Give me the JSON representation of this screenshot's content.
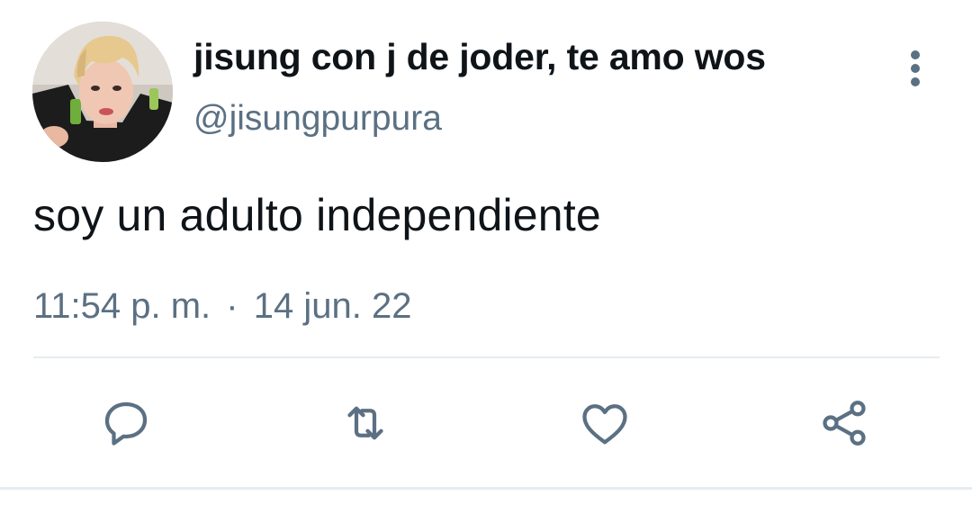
{
  "author": {
    "display_name": "jisung con j de joder, te amo wos",
    "handle": "@jisungpurpura"
  },
  "tweet": {
    "text": "soy un adulto independiente",
    "time": "11:54 p. m.",
    "separator": "·",
    "date": "14 jun. 22"
  },
  "actions": {
    "reply": "reply-icon",
    "retweet": "retweet-icon",
    "like": "heart-icon",
    "share": "share-icon",
    "more": "more-vertical-icon"
  },
  "colors": {
    "text": "#0f1419",
    "secondary": "#5b7083",
    "divider": "#e6ecf0",
    "background": "#ffffff"
  }
}
